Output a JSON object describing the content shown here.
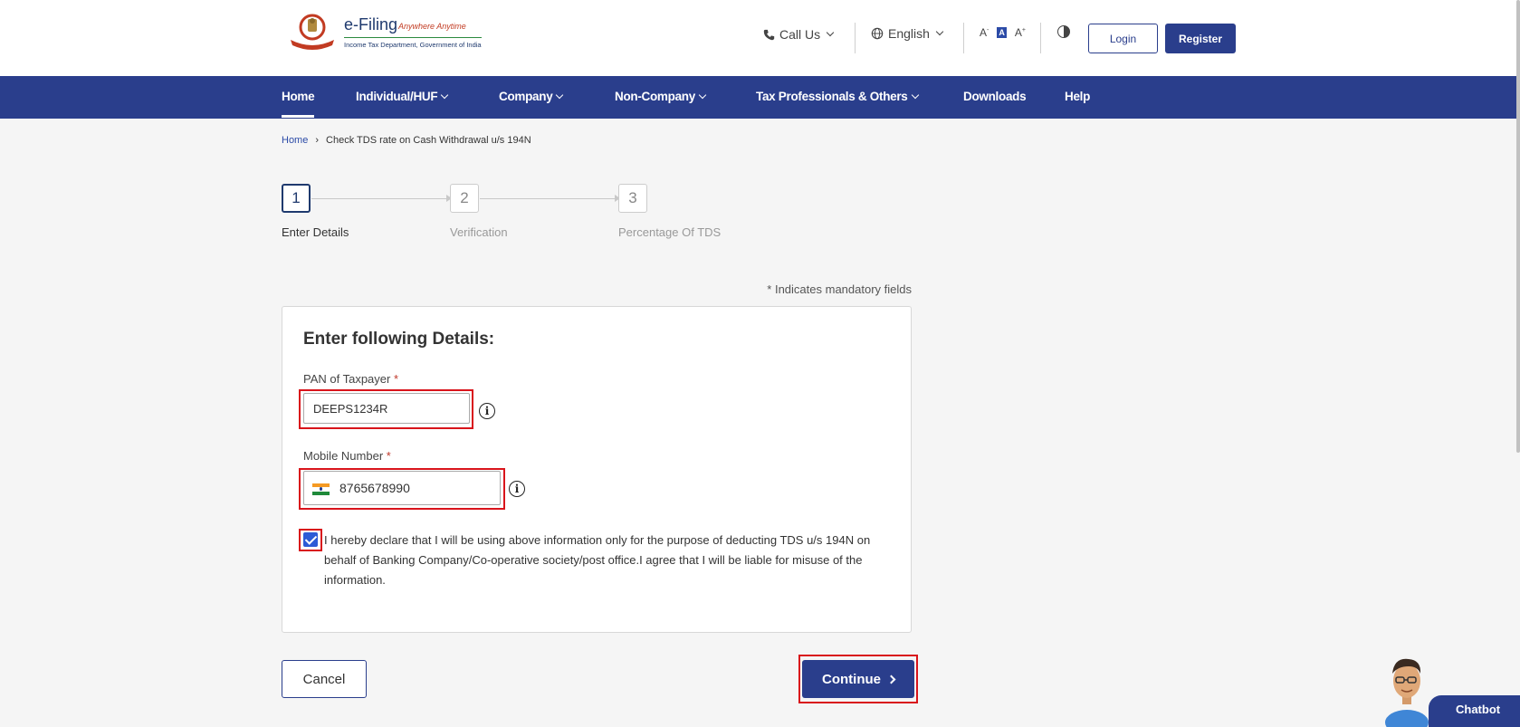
{
  "header": {
    "logo": {
      "title": "e-Filing",
      "tagline": "Anywhere Anytime",
      "subtitle": "Income Tax Department, Government of India"
    },
    "call_us": "Call Us",
    "language": "English",
    "font_controls": [
      "A",
      "A",
      "A"
    ],
    "login_label": "Login",
    "register_label": "Register"
  },
  "nav": {
    "items": [
      {
        "label": "Home",
        "active": true,
        "dropdown": false
      },
      {
        "label": "Individual/HUF",
        "active": false,
        "dropdown": true
      },
      {
        "label": "Company",
        "active": false,
        "dropdown": true
      },
      {
        "label": "Non-Company",
        "active": false,
        "dropdown": true
      },
      {
        "label": "Tax Professionals & Others",
        "active": false,
        "dropdown": true
      },
      {
        "label": "Downloads",
        "active": false,
        "dropdown": false
      },
      {
        "label": "Help",
        "active": false,
        "dropdown": false
      }
    ]
  },
  "breadcrumb": {
    "home": "Home",
    "separator": "›",
    "current": "Check TDS rate on Cash Withdrawal u/s 194N"
  },
  "stepper": {
    "steps": [
      {
        "number": "1",
        "label": "Enter Details",
        "active": true
      },
      {
        "number": "2",
        "label": "Verification",
        "active": false
      },
      {
        "number": "3",
        "label": "Percentage Of TDS",
        "active": false
      }
    ]
  },
  "form": {
    "mandatory_note": "* Indicates mandatory fields",
    "title": "Enter following Details:",
    "pan_label": "PAN of Taxpayer",
    "pan_value": "DEEPS1234R",
    "mobile_label": "Mobile Number",
    "mobile_value": "8765678990",
    "required_mark": "*",
    "info_glyph": "i",
    "declaration_checked": true,
    "declaration": "I hereby declare that I will be using above information only for the purpose of deducting TDS u/s 194N on behalf of Banking Company/Co-operative society/post office.I agree that I will be liable for misuse of the information."
  },
  "actions": {
    "cancel_label": "Cancel",
    "continue_label": "Continue"
  },
  "chatbot": {
    "label": "Chatbot"
  },
  "colors": {
    "primary": "#2a3e8c",
    "highlight": "#d9141b",
    "checkbox": "#2c5bd6"
  }
}
